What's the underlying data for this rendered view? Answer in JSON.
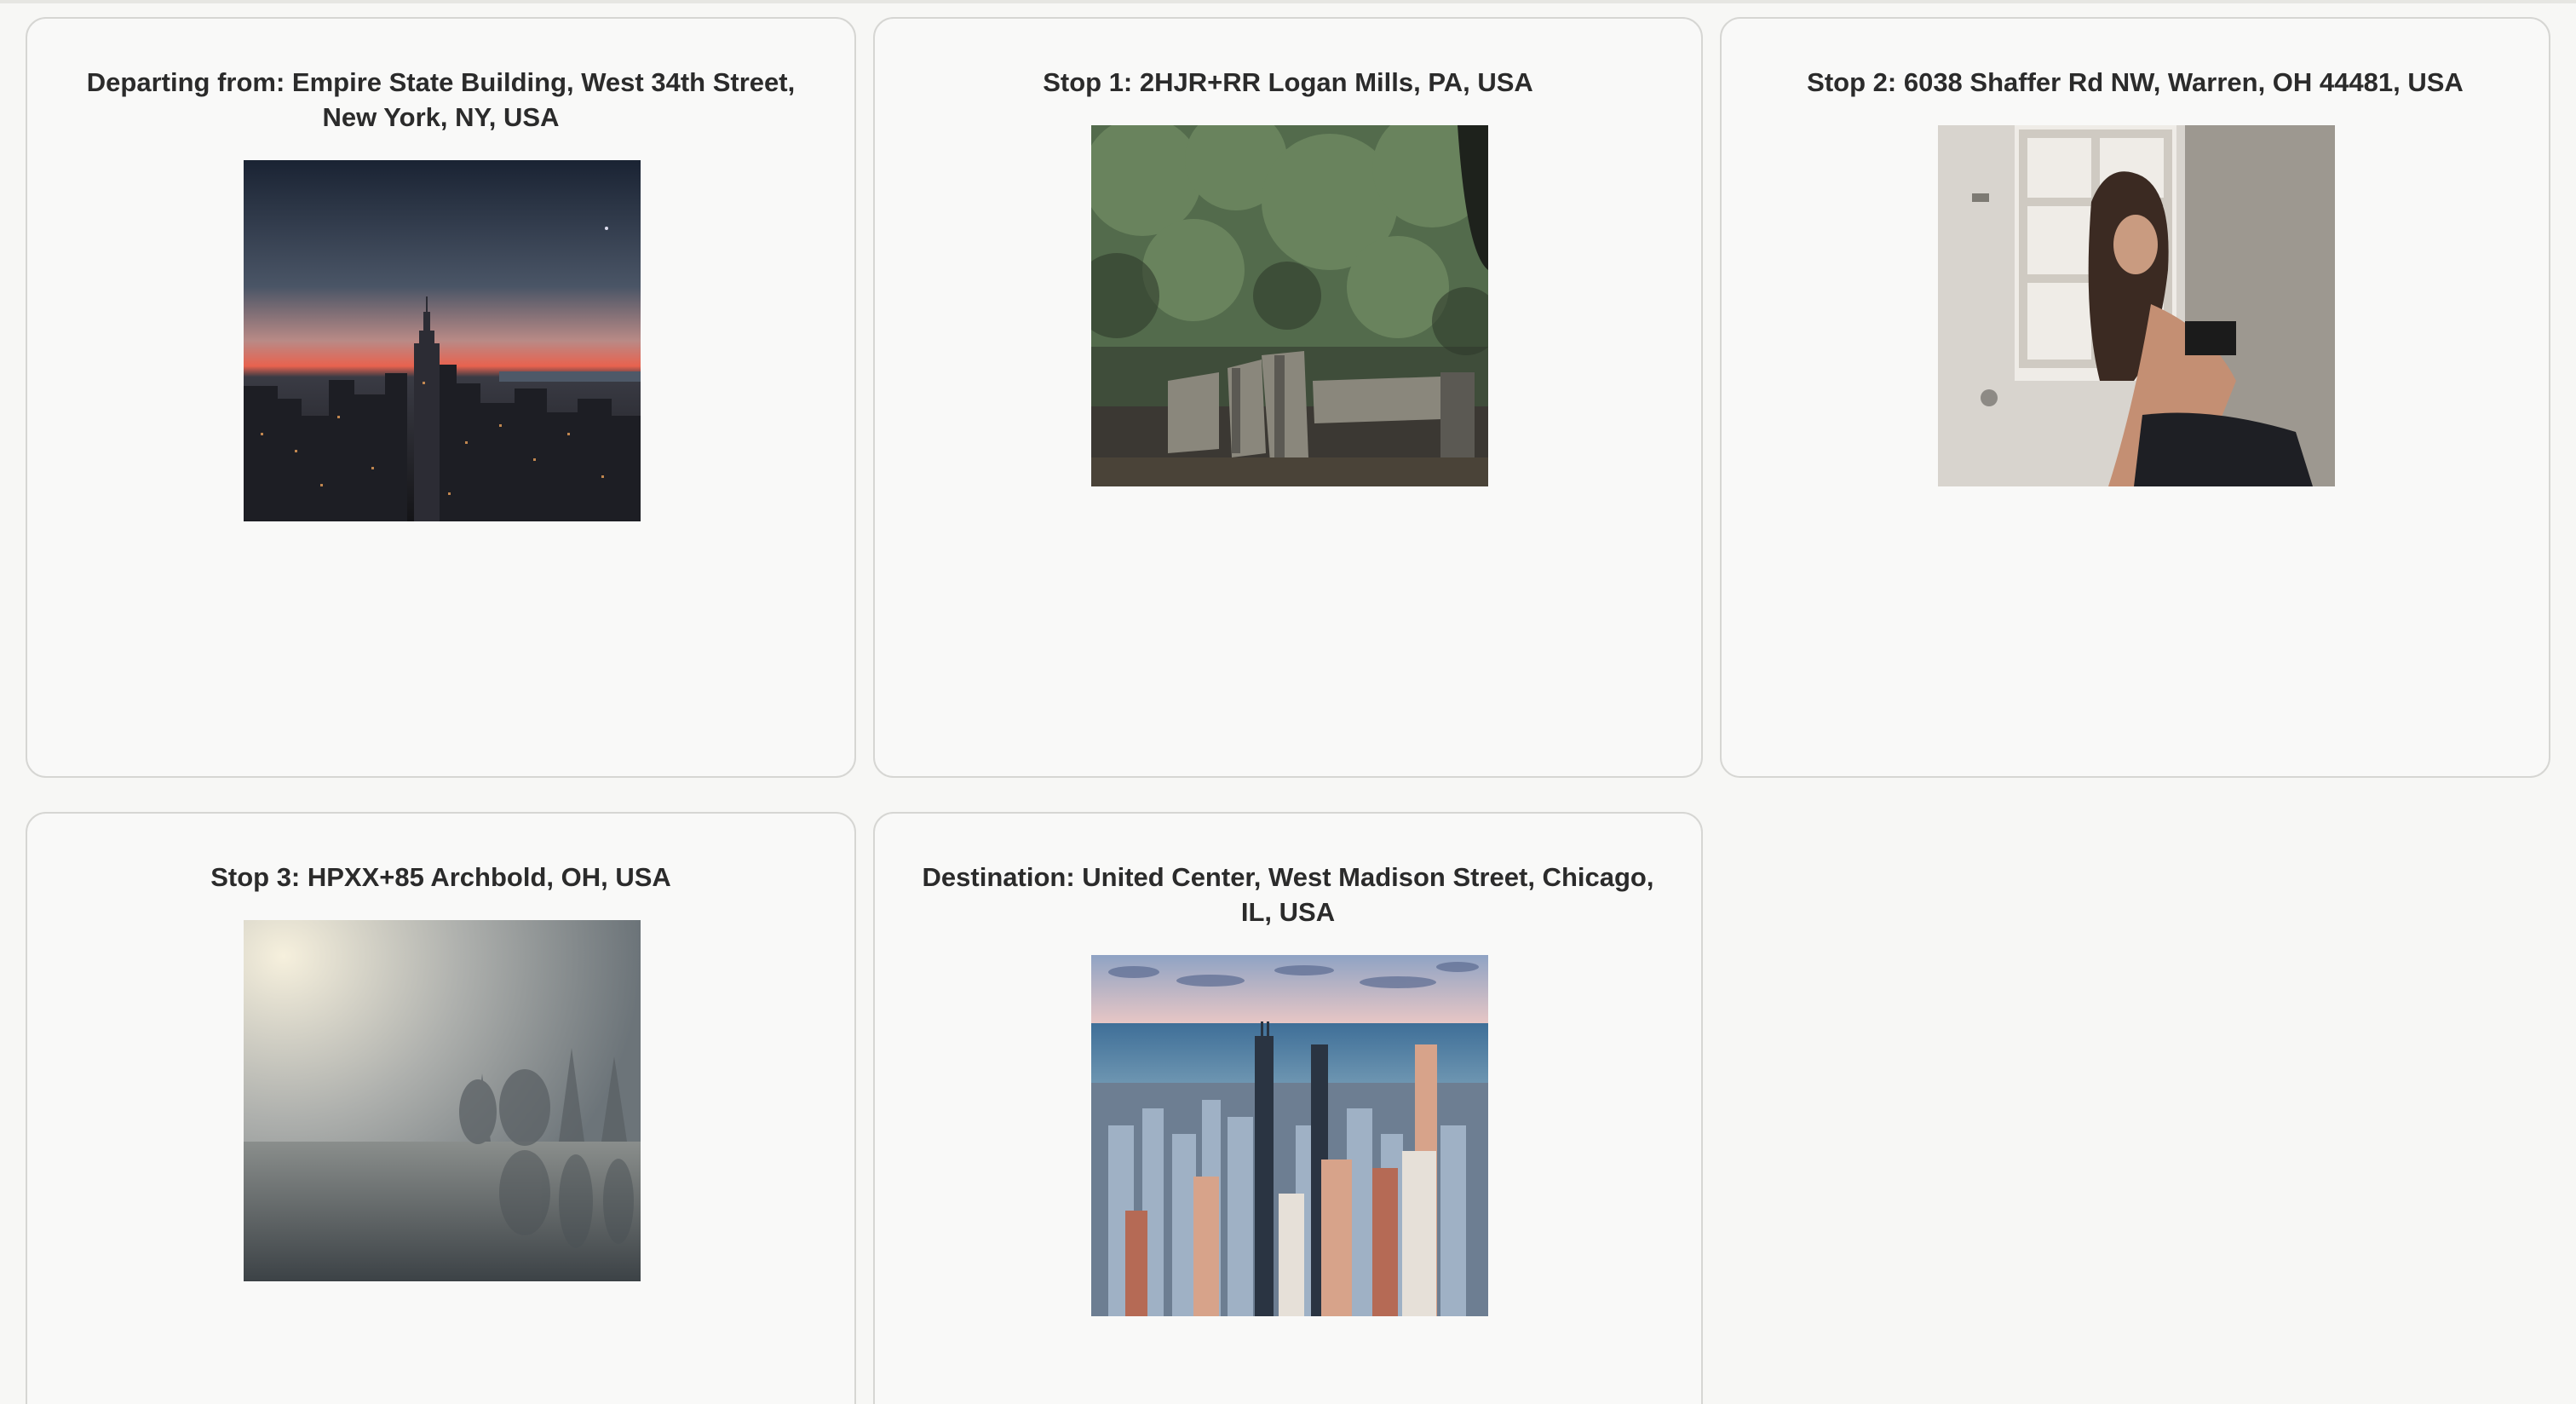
{
  "trip": {
    "stops": [
      {
        "title": "Departing from: Empire State Building, West 34th Street, New York, NY, USA",
        "photo": "new-york-skyline-dusk"
      },
      {
        "title": "Stop 1: 2HJR+RR Logan Mills, PA, USA",
        "photo": "forest-creek-ruins"
      },
      {
        "title": "Stop 2: 6038 Shaffer Rd NW, Warren, OH 44481, USA",
        "photo": "woman-by-window"
      },
      {
        "title": "Stop 3: HPXX+85 Archbold, OH, USA",
        "photo": "foggy-lake-trees"
      },
      {
        "title": "Destination: United Center, West Madison Street, Chicago, IL, USA",
        "photo": "chicago-skyline-aerial"
      }
    ]
  }
}
